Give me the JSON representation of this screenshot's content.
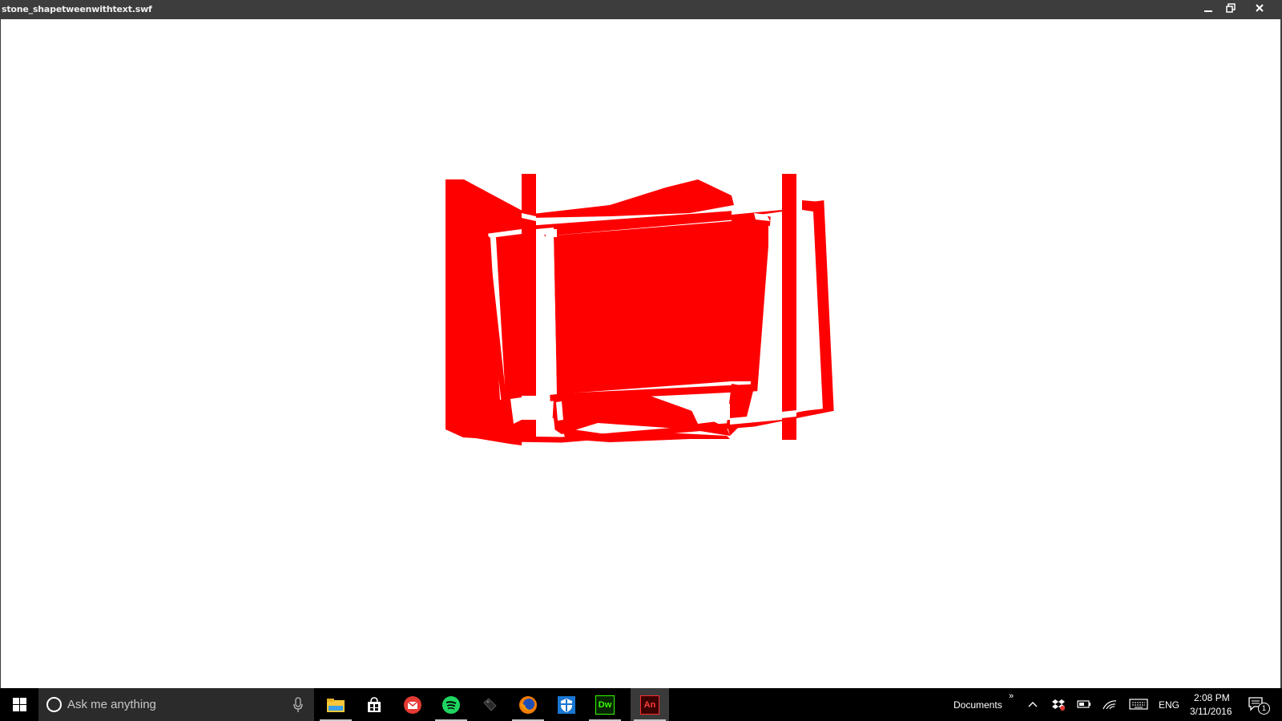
{
  "window": {
    "title": "stone_shapetweenwithtext.swf"
  },
  "search": {
    "placeholder": "Ask me anything"
  },
  "taskbar": {
    "apps": [
      {
        "name": "file-explorer-icon",
        "running": true
      },
      {
        "name": "store-icon",
        "running": false
      },
      {
        "name": "mail-icon",
        "running": false
      },
      {
        "name": "spotify-icon",
        "running": true
      },
      {
        "name": "tag-icon",
        "running": false
      },
      {
        "name": "firefox-icon",
        "running": true
      },
      {
        "name": "security-shield-icon",
        "running": false
      },
      {
        "name": "dreamweaver-icon",
        "running": true,
        "label": "Dw"
      },
      {
        "name": "animate-icon",
        "running": true,
        "active": true,
        "label": "An"
      }
    ],
    "toolbar_label": "Documents",
    "toolbar_chevron": "»",
    "language": "ENG",
    "time": "2:08 PM",
    "date": "3/11/2016",
    "notification_count": "1"
  },
  "colors": {
    "shape_red": "#ff0000",
    "titlebar": "#3d3d3d",
    "taskbar": "#000000",
    "search_bg": "#2b2b2b"
  }
}
